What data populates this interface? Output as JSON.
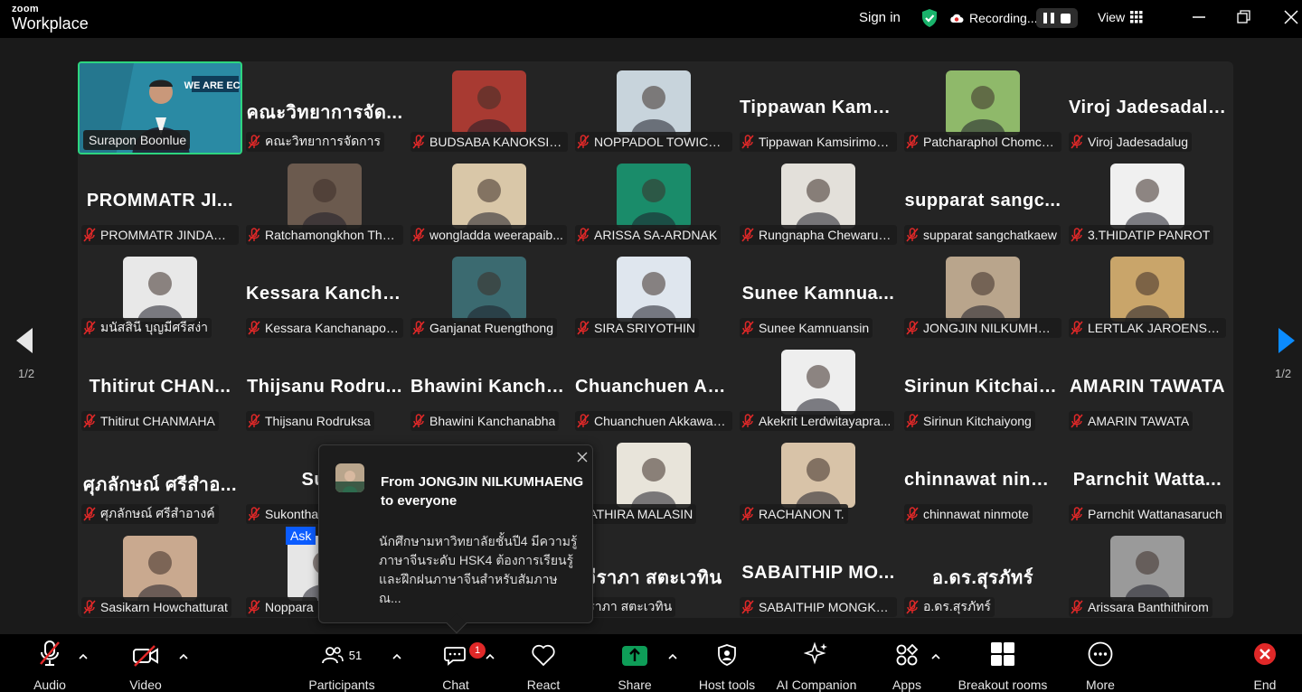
{
  "topbar": {
    "logo_line1": "zoom",
    "logo_line2": "Workplace",
    "sign_in": "Sign in",
    "recording": "Recording...",
    "view": "View"
  },
  "gallery": {
    "page_indicator_left": "1/2",
    "page_indicator_right": "1/2",
    "tiles": [
      {
        "big": "",
        "label": "Surapon Boonlue",
        "photo": "video",
        "muted": false,
        "active": true,
        "bg": "#1f6f86"
      },
      {
        "big": "คณะวิทยาการจัด...",
        "label": "คณะวิทยาการจัดการ",
        "photo": "",
        "muted": true
      },
      {
        "big": "",
        "label": "BUDSABA KANOKSILA...",
        "photo": "#a83a32",
        "muted": true
      },
      {
        "big": "",
        "label": "NOPPADOL TOWICHAI...",
        "photo": "#c8d4dc",
        "muted": true
      },
      {
        "big": "Tippawan  Kams...",
        "label": "Tippawan Kamsirimon...",
        "photo": "",
        "muted": true
      },
      {
        "big": "",
        "label": "Patcharaphol Chomch...",
        "photo": "#8fb96a",
        "muted": true
      },
      {
        "big": "Viroj Jadesadalug",
        "label": "Viroj Jadesadalug",
        "photo": "",
        "muted": true
      },
      {
        "big": "PROMMATR  JI...",
        "label": "PROMMATR JINDACH...",
        "photo": "",
        "muted": true
      },
      {
        "big": "",
        "label": "Ratchamongkhon Tho...",
        "photo": "#6b5a4e",
        "muted": true
      },
      {
        "big": "",
        "label": "wongladda weerapaib...",
        "photo": "#d9c7a8",
        "muted": true
      },
      {
        "big": "",
        "label": "ARISSA SA-ARDNAK",
        "photo": "#1a8c6a",
        "muted": true
      },
      {
        "big": "",
        "label": "Rungnapha Chewarus...",
        "photo": "#e3e0da",
        "muted": true
      },
      {
        "big": "supparat  sangc...",
        "label": "supparat sangchatkaew",
        "photo": "",
        "muted": true
      },
      {
        "big": "",
        "label": "3.THIDATIP PANROT",
        "photo": "#f0f0f0",
        "muted": true
      },
      {
        "big": "",
        "label": "มนัสสินี บุญมีศรีสง่า",
        "photo": "#e8e8e8",
        "muted": true
      },
      {
        "big": "Kessara  Kancha...",
        "label": "Kessara Kanchanapoom",
        "photo": "",
        "muted": true
      },
      {
        "big": "",
        "label": "Ganjanat Ruengthong",
        "photo": "#3b6a70",
        "muted": true
      },
      {
        "big": "",
        "label": "SIRA SRIYOTHIN",
        "photo": "#dfe6ee",
        "muted": true
      },
      {
        "big": "Sunee  Kamnua...",
        "label": "Sunee Kamnuansin",
        "photo": "",
        "muted": true
      },
      {
        "big": "",
        "label": "JONGJIN NILKUMHAE...",
        "photo": "#b9a58c",
        "muted": true
      },
      {
        "big": "",
        "label": "LERTLAK JAROENSOM...",
        "photo": "#c9a56a",
        "muted": true
      },
      {
        "big": "Thitirut  CHAN...",
        "label": "Thitirut CHANMAHA",
        "photo": "",
        "muted": true
      },
      {
        "big": "Thijsanu  Rodru...",
        "label": "Thijsanu Rodruksa",
        "photo": "",
        "muted": true
      },
      {
        "big": "Bhawini  Kancha...",
        "label": "Bhawini Kanchanabha",
        "photo": "",
        "muted": true
      },
      {
        "big": "Chuanchuen  Ak...",
        "label": "Chuanchuen Akkawan...",
        "photo": "",
        "muted": true
      },
      {
        "big": "",
        "label": "Akekrit Lerdwitayapra...",
        "photo": "#eeeeee",
        "muted": true
      },
      {
        "big": "Sirinun  Kitchaiy...",
        "label": "Sirinun Kitchaiyong",
        "photo": "",
        "muted": true
      },
      {
        "big": "AMARIN TAWATA",
        "label": "AMARIN TAWATA",
        "photo": "",
        "muted": true
      },
      {
        "big": "ศุภลักษณ์  ศรีสำอ...",
        "label": "ศุภลักษณ์ ศรีสำอางค์",
        "photo": "",
        "muted": true
      },
      {
        "big": "Suko",
        "label": "Sukontha",
        "photo": "",
        "muted": true
      },
      {
        "big": "",
        "label": "",
        "photo": "",
        "muted": false,
        "hidden": true
      },
      {
        "big": "",
        "label": "SATHIRA MALASIN",
        "photo": "#e8e4da",
        "muted": false
      },
      {
        "big": "",
        "label": "RACHANON T.",
        "photo": "#d8c3a8",
        "muted": true
      },
      {
        "big": "chinnawat  ninm...",
        "label": "chinnawat ninmote",
        "photo": "",
        "muted": true
      },
      {
        "big": "Parnchit  Watta...",
        "label": "Parnchit Wattanasaruch",
        "photo": "",
        "muted": true
      },
      {
        "big": "",
        "label": "Sasikarn Howchatturat",
        "photo": "#c9a98f",
        "muted": true
      },
      {
        "big": "",
        "label": "Noppara",
        "photo": "#e6e6e6",
        "muted": true,
        "ask": "Ask"
      },
      {
        "big": "",
        "label": "",
        "photo": "",
        "muted": false,
        "hidden": true
      },
      {
        "big": "จีราภา  สตะเวทิน",
        "label": "จีราภา สตะเวทิน",
        "photo": "",
        "muted": false
      },
      {
        "big": "SABAITHIP  MO...",
        "label": "SABAITHIP MONGKOLI...",
        "photo": "",
        "muted": true
      },
      {
        "big": "อ.ดร.สุรภัทร์",
        "label": "อ.ดร.สุรภัทร์",
        "photo": "",
        "muted": true
      },
      {
        "big": "",
        "label": "Arissara Banthithirom",
        "photo": "#9a9a9a",
        "muted": true
      }
    ]
  },
  "chat_popup": {
    "from_line1": "From JONGJIN NILKUMHAENG",
    "from_line2": "to everyone",
    "message_line1": "นักศึกษามหาวิทยาลัยชั้นปี4 มีความรู้",
    "message_line2": "ภาษาจีนระดับ HSK4 ต้องการเรียนรู้",
    "message_line3": "และฝึกฝนภาษาจีนสำหรับสัมภาษณ..."
  },
  "toolbar": {
    "audio": "Audio",
    "video": "Video",
    "participants": "Participants",
    "participants_count": "51",
    "chat": "Chat",
    "chat_badge": "1",
    "react": "React",
    "share": "Share",
    "host_tools": "Host tools",
    "ai_companion": "AI Companion",
    "apps": "Apps",
    "breakout_rooms": "Breakout rooms",
    "more": "More",
    "end": "End"
  },
  "colors": {
    "active_speaker_border": "#2dd57f",
    "share_green": "#0e9d58",
    "end_red": "#e02828",
    "muted_red": "#e02828",
    "nav_blue": "#0b8bff",
    "badge_red": "#e02828"
  }
}
